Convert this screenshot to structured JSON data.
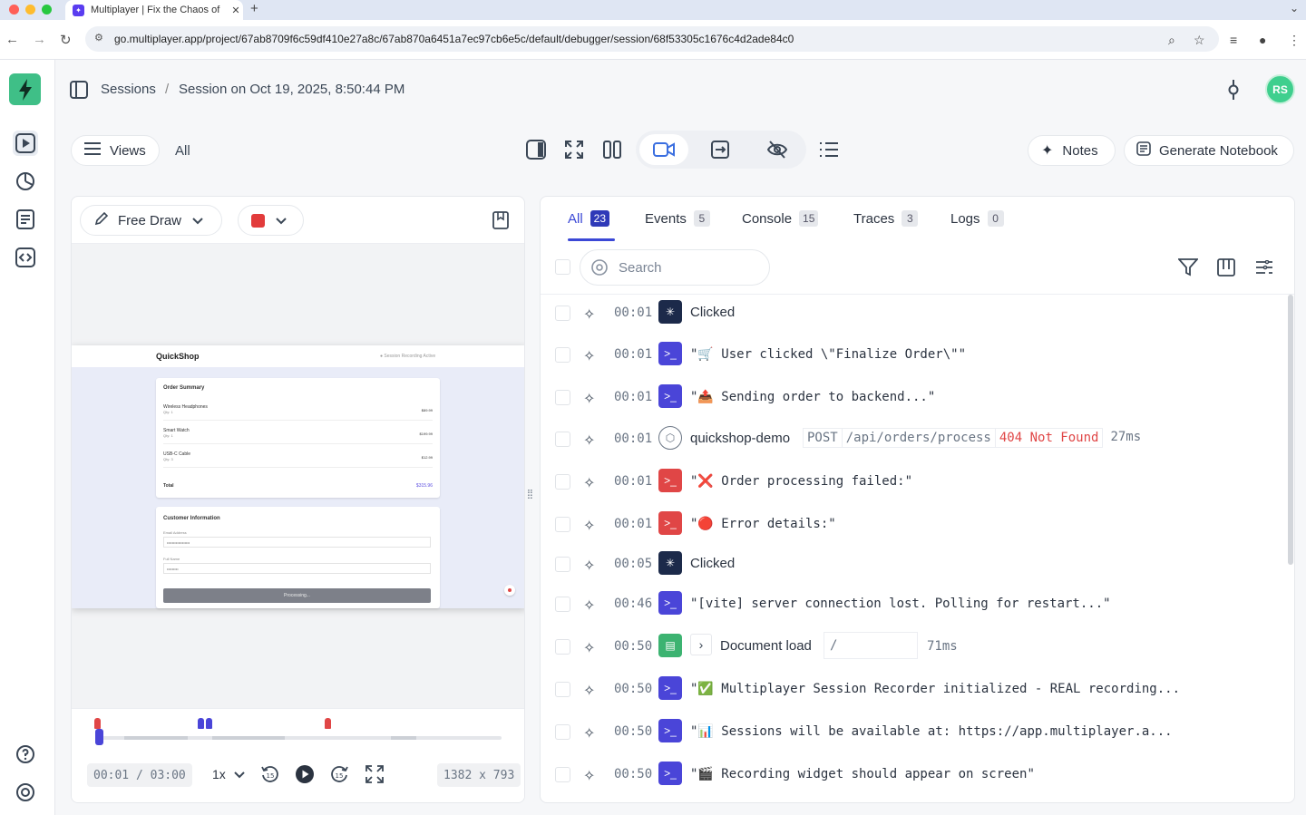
{
  "browser": {
    "tab_title": "Multiplayer | Fix the Chaos of",
    "tab_close": "✕",
    "new_tab": "+",
    "url": "go.multiplayer.app/project/67ab8709f6c59df410e27a8c/67ab870a6451a7ec97cb6e5c/default/debugger/session/68f53305c1676c4d2ade84c0"
  },
  "header": {
    "breadcrumb_root": "Sessions",
    "breadcrumb_sep": "/",
    "breadcrumb_current": "Session on Oct 19, 2025, 8:50:44 PM",
    "avatar_initials": "RS"
  },
  "toolbar": {
    "views_label": "Views",
    "filter_label": "All",
    "notes_label": "Notes",
    "generate_label": "Generate Notebook"
  },
  "annotation": {
    "tool_label": "Free Draw",
    "color": "#e23b3b"
  },
  "recording": {
    "app_title": "QuickShop",
    "status": "● Session Recording Active",
    "order_title": "Order Summary",
    "items": [
      {
        "name": "Wireless Headphones",
        "qty": "Qty: 1",
        "price": "$89.99"
      },
      {
        "name": "Smart Watch",
        "qty": "Qty: 1",
        "price": "$199.99"
      },
      {
        "name": "USB-C Cable",
        "qty": "Qty: 3",
        "price": "$12.99"
      }
    ],
    "total_label": "Total",
    "total_value": "$315.96",
    "customer_title": "Customer Information",
    "email_label": "Email Address",
    "email_value": "••••••••••••••••••",
    "name_label": "Full Name",
    "name_value": "•••••••••",
    "button_label": "Processing..."
  },
  "player": {
    "time": "00:01 / 03:00",
    "speed": "1x",
    "resolution": "1382 x 793",
    "progress_fraction": 0.005
  },
  "tabs": [
    {
      "label": "All",
      "count": "23"
    },
    {
      "label": "Events",
      "count": "5"
    },
    {
      "label": "Console",
      "count": "15"
    },
    {
      "label": "Traces",
      "count": "3"
    },
    {
      "label": "Logs",
      "count": "0"
    }
  ],
  "search": {
    "placeholder": "Search"
  },
  "rows": [
    {
      "time": "00:01",
      "type": "click",
      "text": "Clicked"
    },
    {
      "time": "00:01",
      "type": "console",
      "text": "\"🛒 User clicked \\\"Finalize Order\\\"\""
    },
    {
      "time": "00:01",
      "type": "console",
      "text": "\"📤 Sending order to backend...\""
    },
    {
      "time": "00:01",
      "type": "trace",
      "text": "quickshop-demo",
      "method": "POST",
      "path": "/api/orders/process",
      "status": "404 Not Found",
      "duration": "27ms"
    },
    {
      "time": "00:01",
      "type": "error",
      "text": "\"❌ Order processing failed:\""
    },
    {
      "time": "00:01",
      "type": "error",
      "text": "\"🔴 Error details:\""
    },
    {
      "time": "00:05",
      "type": "click",
      "text": "Clicked"
    },
    {
      "time": "00:46",
      "type": "console",
      "text": "\"[vite] server connection lost. Polling for restart...\""
    },
    {
      "time": "00:50",
      "type": "doc",
      "text": "Document load",
      "path": "/",
      "duration": "71ms"
    },
    {
      "time": "00:50",
      "type": "console",
      "text": "\"✅ Multiplayer Session Recorder initialized - REAL recording..."
    },
    {
      "time": "00:50",
      "type": "console",
      "text": "\"📊 Sessions will be available at: https://app.multiplayer.a..."
    },
    {
      "time": "00:50",
      "type": "console",
      "text": "\"🎬 Recording widget should appear on screen\""
    }
  ],
  "colors": {
    "brand": "#3fbf87",
    "accent": "#3b48d6",
    "console": "#4a45d8",
    "error": "#e04646",
    "click": "#1c2a4a",
    "doc": "#3cb371",
    "http_error": "#e04646"
  }
}
